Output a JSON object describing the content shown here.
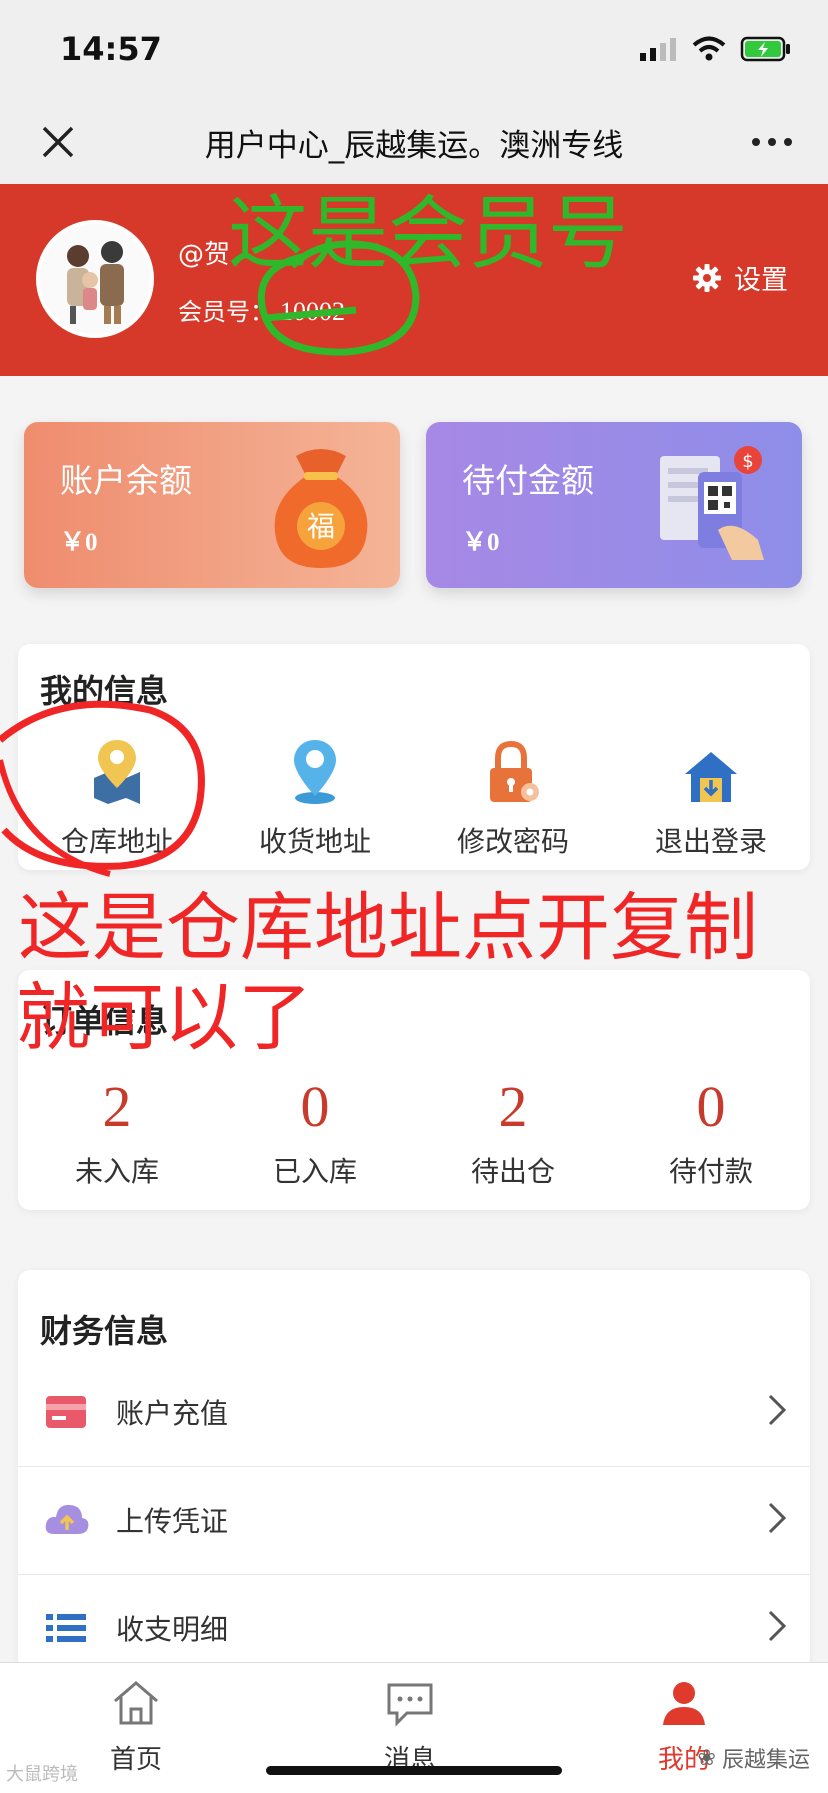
{
  "status": {
    "time": "14:57"
  },
  "nav": {
    "title": "用户中心_辰越集运。澳洲专线"
  },
  "profile": {
    "username": "@贺",
    "member_label": "会员号：",
    "member_number": "10002",
    "settings_label": "设置"
  },
  "cards": {
    "balance": {
      "title": "账户余额",
      "amount": "￥0"
    },
    "pending": {
      "title": "待付金额",
      "amount": "￥0"
    }
  },
  "my_info": {
    "title": "我的信息",
    "items": [
      {
        "label": "仓库地址",
        "icon": "map-pin-icon"
      },
      {
        "label": "收货地址",
        "icon": "location-icon"
      },
      {
        "label": "修改密码",
        "icon": "lock-icon"
      },
      {
        "label": "退出登录",
        "icon": "logout-house-icon"
      }
    ]
  },
  "orders": {
    "title": "订单信息",
    "items": [
      {
        "count": "2",
        "label": "未入库"
      },
      {
        "count": "0",
        "label": "已入库"
      },
      {
        "count": "2",
        "label": "待出仓"
      },
      {
        "count": "0",
        "label": "待付款"
      }
    ]
  },
  "finance": {
    "title": "财务信息",
    "items": [
      {
        "label": "账户充值",
        "icon": "card-icon"
      },
      {
        "label": "上传凭证",
        "icon": "cloud-upload-icon"
      },
      {
        "label": "收支明细",
        "icon": "list-icon"
      }
    ]
  },
  "tabs": [
    {
      "label": "首页",
      "icon": "home-icon"
    },
    {
      "label": "消息",
      "icon": "message-icon"
    },
    {
      "label": "我的",
      "icon": "user-icon",
      "active": true
    }
  ],
  "annotations": {
    "green": "这是会员号",
    "red_line1": "这是仓库地址点开复制",
    "red_line2": "就可以了"
  },
  "watermarks": {
    "left": "大鼠跨境",
    "right": "辰越集运"
  },
  "colors": {
    "brand_red": "#d6392a",
    "balance_card": "#ef8c6e",
    "pending_card": "#a788e6",
    "count_red": "#c73a2c",
    "annotation_green": "#2fb82a",
    "annotation_red": "#f02626"
  }
}
